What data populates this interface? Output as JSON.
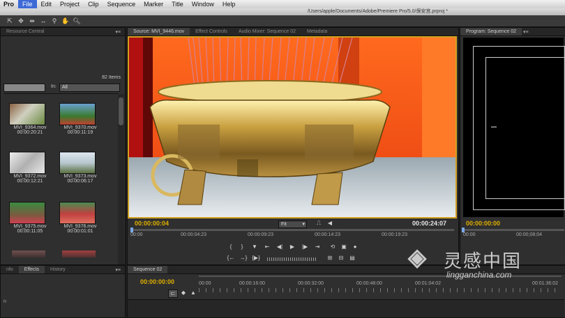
{
  "menubar": {
    "app": "Pro",
    "items": [
      "File",
      "Edit",
      "Project",
      "Clip",
      "Sequence",
      "Marker",
      "Title",
      "Window",
      "Help"
    ]
  },
  "titlebar": {
    "path": "/Users/apple/Documents/Adobe/Premiere Pro/5.0/保安宫.prproj *"
  },
  "project_panel": {
    "tab": "Resource Central",
    "item_count": "82 Items",
    "in_label": "In:",
    "in_value": "All",
    "clips": [
      {
        "name": "MVI_9364.mov",
        "duration": "00:00:20:21"
      },
      {
        "name": "MVI_9370.mov",
        "duration": "00:00:11:19"
      },
      {
        "name": "MVI_9372.mov",
        "duration": "00:00:12:21"
      },
      {
        "name": "MVI_9373.mov",
        "duration": "00:00:06:17"
      },
      {
        "name": "MVI_9375.mov",
        "duration": "00:00:11:05"
      },
      {
        "name": "MVI_9376.mov",
        "duration": "00:00:01:01"
      }
    ]
  },
  "effects_panel": {
    "tabs": [
      "nfo",
      "Effects",
      "History"
    ],
    "side_label": "n"
  },
  "source_monitor": {
    "tabs": [
      "Source: MVI_9446.mov",
      "Effect Controls",
      "Audio Mixer: Sequence 02",
      "Metadata"
    ],
    "current_time": "00:00:00:04",
    "fit": "Fit",
    "duration": "00:00:24:07",
    "ruler": [
      "00:00",
      "00:00:04:23",
      "00:00:09:23",
      "00:00:14:23",
      "00:00:19:23"
    ]
  },
  "program_monitor": {
    "tab": "Program: Sequence 02",
    "current_time": "00:00:00:00",
    "ruler": [
      "00:00",
      "00:00;08;04"
    ]
  },
  "timeline": {
    "tab": "Sequence 02",
    "current_time": "00:00:00:00",
    "ruler": [
      "00:00",
      "00:00:16:00",
      "00:00:32:00",
      "00:00:48:00",
      "00:01:04:02",
      "00:01:36:02"
    ]
  },
  "watermark": {
    "cn": "灵感中国",
    "url": "lingganchina.com"
  }
}
